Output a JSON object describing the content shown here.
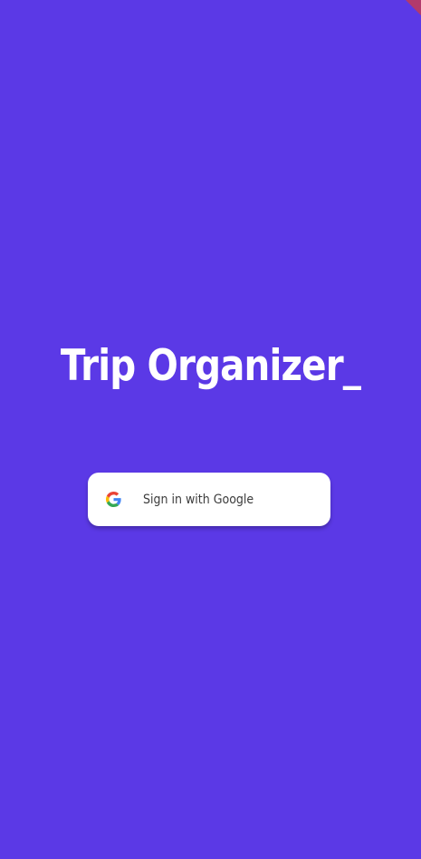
{
  "app": {
    "title": "Trip Organizer_"
  },
  "signin": {
    "label": "Sign in with Google",
    "icon": "google-g-icon"
  },
  "colors": {
    "background": "#5b39e6",
    "button": "#ffffff",
    "banner": "#b23a6c"
  }
}
